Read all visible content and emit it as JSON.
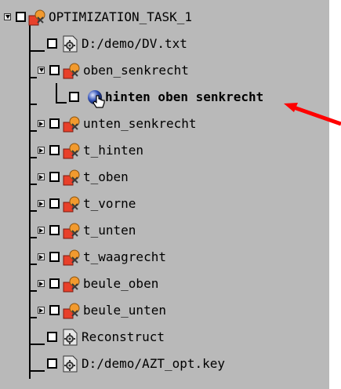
{
  "tree": {
    "root": {
      "label": "OPTIMIZATION_TASK_1",
      "checked": false,
      "expanded": true,
      "icon": "task-icon"
    },
    "children": [
      {
        "label": "D:/demo/DV.txt",
        "checked": false,
        "icon": "gear-file-icon"
      },
      {
        "label": "oben_senkrecht",
        "checked": false,
        "expanded": true,
        "icon": "task-icon",
        "children": [
          {
            "label": "hinten oben senkrecht",
            "checked": false,
            "icon": "ball-icon"
          }
        ]
      },
      {
        "label": "unten_senkrecht",
        "checked": false,
        "expanded": false,
        "icon": "task-icon"
      },
      {
        "label": "t_hinten",
        "checked": false,
        "expanded": false,
        "icon": "task-icon"
      },
      {
        "label": "t_oben",
        "checked": false,
        "expanded": false,
        "icon": "task-icon"
      },
      {
        "label": "t_vorne",
        "checked": false,
        "expanded": false,
        "icon": "task-icon"
      },
      {
        "label": "t_unten",
        "checked": false,
        "expanded": false,
        "icon": "task-icon"
      },
      {
        "label": "t_waagrecht",
        "checked": false,
        "expanded": false,
        "icon": "task-icon"
      },
      {
        "label": "beule_oben",
        "checked": false,
        "expanded": false,
        "icon": "task-icon"
      },
      {
        "label": "beule_unten",
        "checked": false,
        "expanded": false,
        "icon": "task-icon"
      },
      {
        "label": "Reconstruct",
        "checked": false,
        "icon": "gear-file-icon"
      },
      {
        "label": "D:/demo/AZT_opt.key",
        "checked": false,
        "icon": "gear-file-icon"
      }
    ]
  },
  "annotation": {
    "arrow_color": "#ff0000",
    "icon": "red-arrow-icon"
  },
  "colors": {
    "background": "#b9b9b9",
    "task_red": "#e8402a",
    "task_orange": "#f29a2e",
    "ball_blue": "#2f4fb4",
    "gear_file": "#e6e6e6"
  }
}
